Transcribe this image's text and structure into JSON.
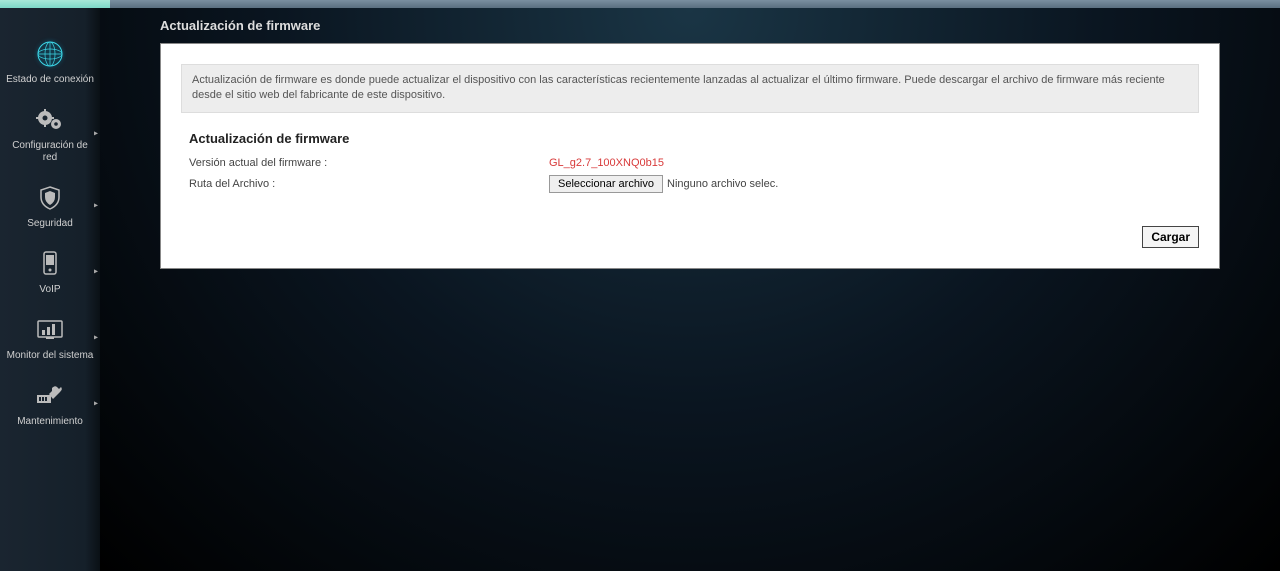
{
  "sidebar": {
    "items": [
      {
        "label": "Estado de conexión"
      },
      {
        "label": "Configuración de red"
      },
      {
        "label": "Seguridad"
      },
      {
        "label": "VoIP"
      },
      {
        "label": "Monitor del sistema"
      },
      {
        "label": "Mantenimiento"
      }
    ]
  },
  "page": {
    "title": "Actualización de firmware",
    "info": "Actualización de firmware es donde puede actualizar el dispositivo con las características recientemente lanzadas al actualizar el último firmware. Puede descargar el archivo de firmware más reciente desde el sitio web del fabricante de este dispositivo.",
    "section_title": "Actualización de firmware",
    "version_label": "Versión actual del firmware :",
    "version_value": "GL_g2.7_100XNQ0b15",
    "filepath_label": "Ruta del Archivo :",
    "file_button": "Seleccionar archivo",
    "file_status": "Ninguno archivo selec.",
    "load_button": "Cargar"
  }
}
